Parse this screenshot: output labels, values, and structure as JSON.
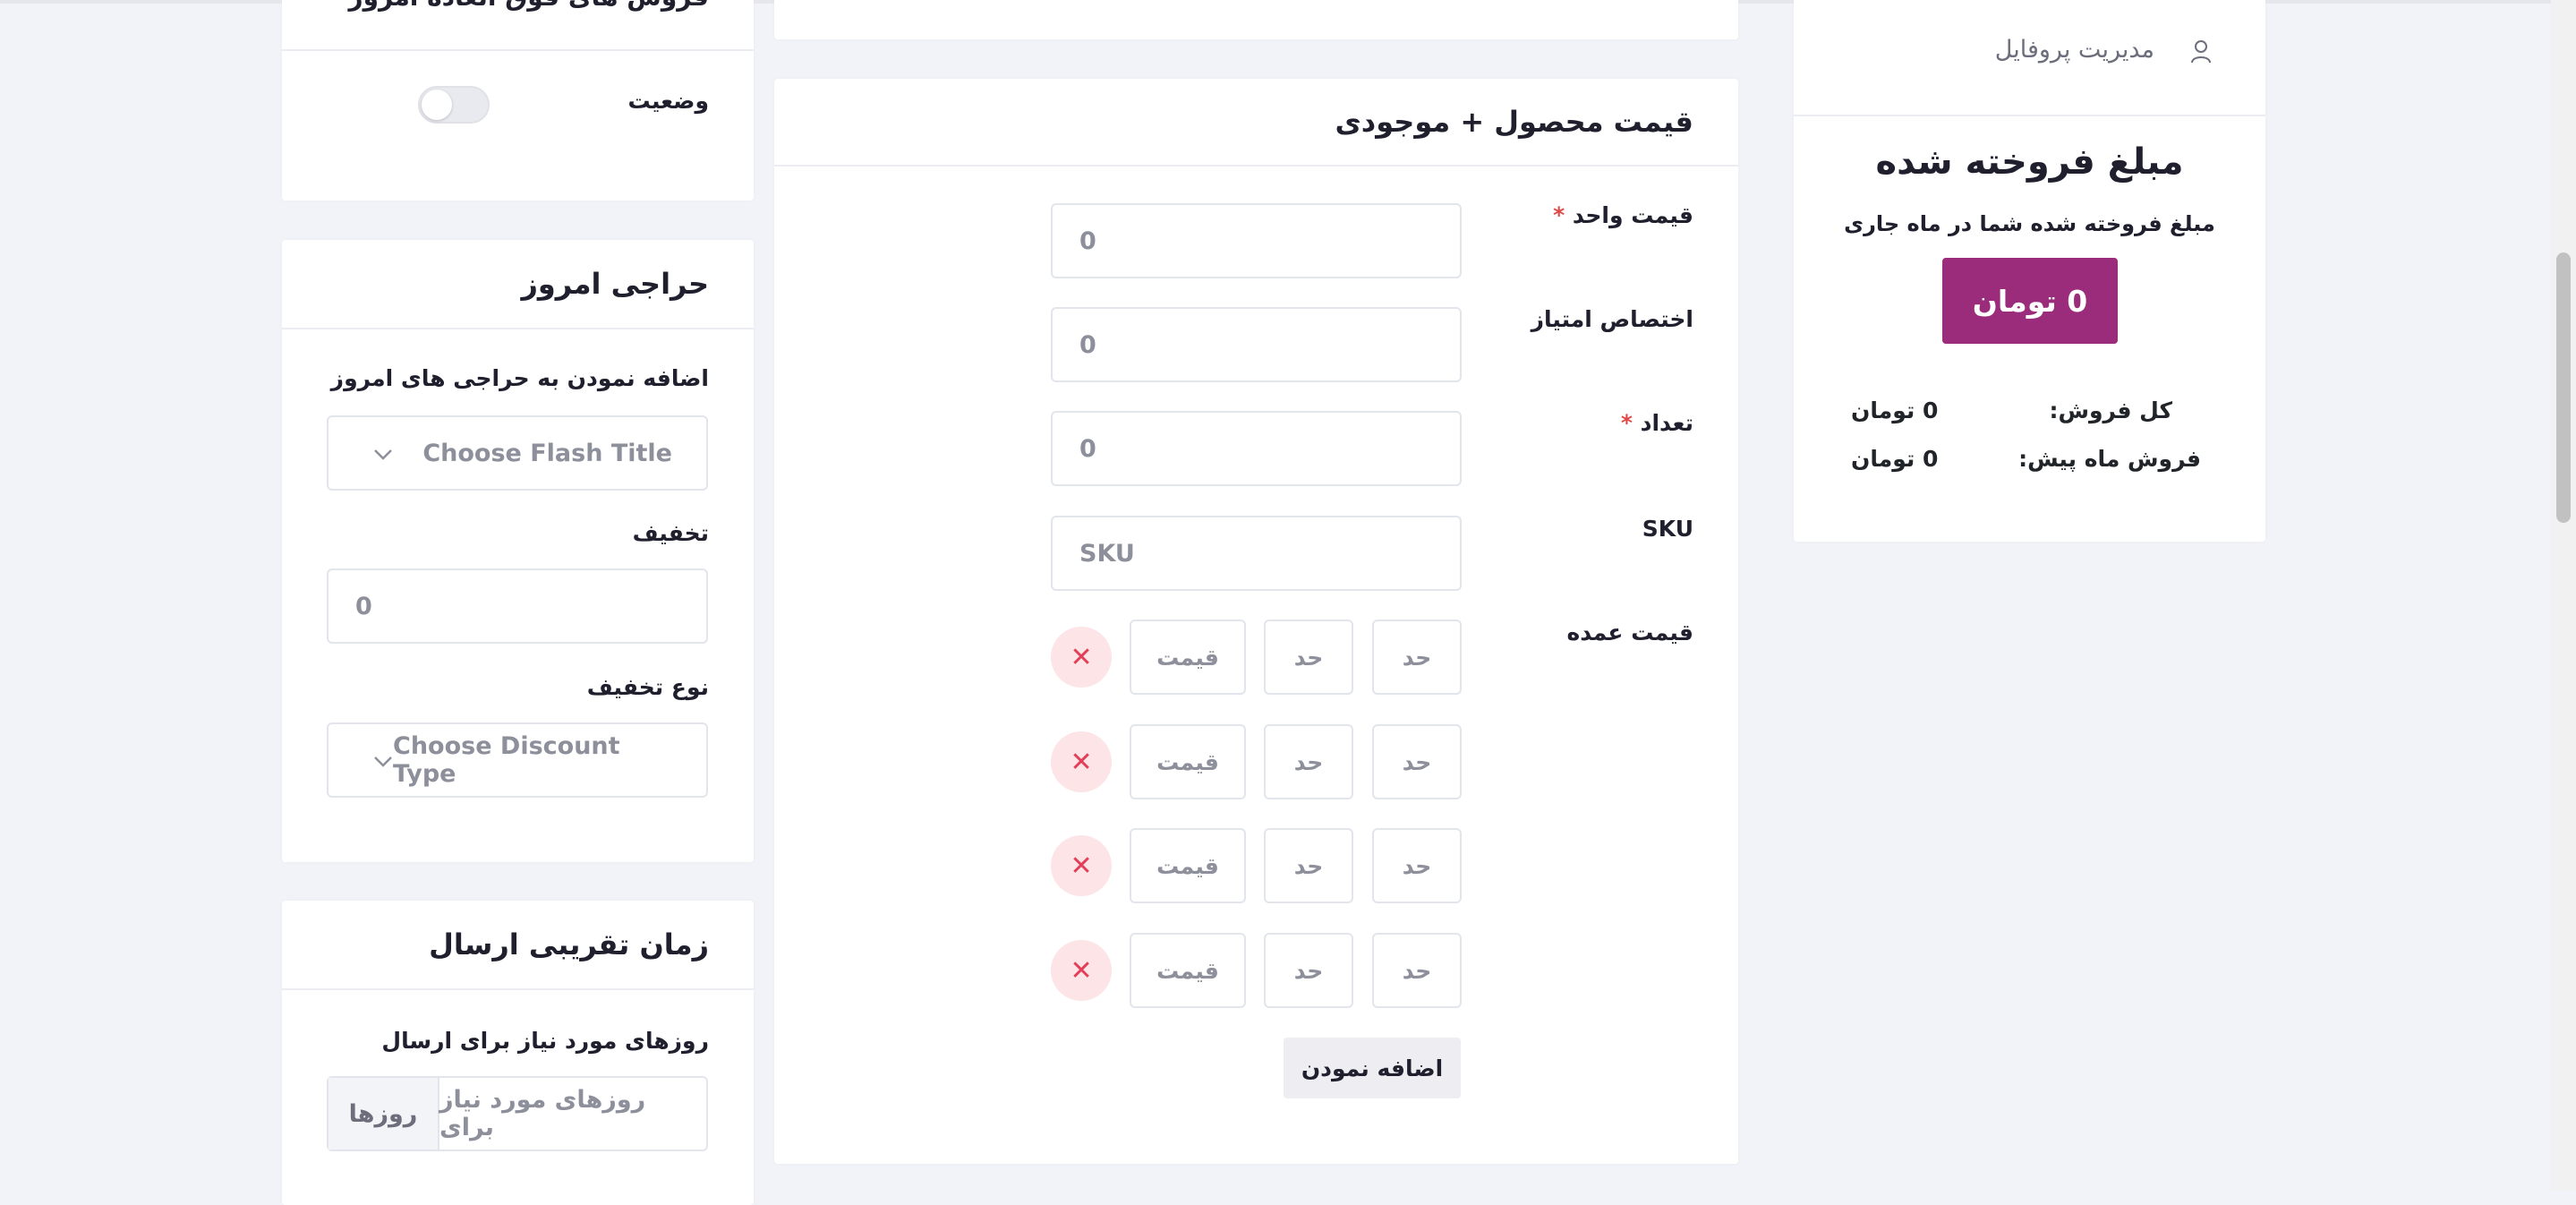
{
  "colors": {
    "accent": "#9b2c7b",
    "background": "#f2f3f8",
    "danger": "#e23e57",
    "danger_bg": "#fce4e7"
  },
  "left": {
    "top_card": {
      "partial_title": "فروش های فوق العاده امروز",
      "status_label": "وضعیت"
    },
    "flash": {
      "title": "حراجی امروز",
      "add_label": "اضافه نمودن به حراجی های امروز",
      "select_placeholder": "Choose Flash Title",
      "discount_label": "تخفیف",
      "discount_value": "0",
      "discount_type_label": "نوع تخفیف",
      "discount_type_placeholder": "Choose Discount Type"
    },
    "shipping": {
      "title": "زمان تقریبی ارسال",
      "days_label": "روزهای مورد نیاز برای ارسال",
      "days_placeholder": "روزهای مورد نیاز برای",
      "days_suffix": "روزها"
    }
  },
  "middle": {
    "title": "قیمت محصول + موجودی",
    "unit_price_label": "قیمت واحد",
    "unit_price_value": "0",
    "points_label": "اختصاص امتیاز",
    "points_value": "0",
    "quantity_label": "تعداد",
    "quantity_value": "0",
    "sku_label": "SKU",
    "sku_placeholder": "SKU",
    "wholesale_label": "قیمت عمده",
    "wholesale_rows": [
      {
        "min": "حد",
        "max": "حد",
        "price": "قیمت"
      },
      {
        "min": "حد",
        "max": "حد",
        "price": "قیمت"
      },
      {
        "min": "حد",
        "max": "حد",
        "price": "قیمت"
      },
      {
        "min": "حد",
        "max": "حد",
        "price": "قیمت"
      }
    ],
    "add_button": "اضافه نمودن",
    "required_mark": "*"
  },
  "right": {
    "profile_label": "مدیریت پروفایل",
    "sold_title": "مبلغ فروخته شده",
    "sold_subtitle": "مبلغ فروخته شده شما در ماه جاری",
    "sold_amount": "0 تومان",
    "total_sales_label": "کل فروش:",
    "total_sales_value": "0 تومان",
    "last_month_label": "فروش ماه پیش:",
    "last_month_value": "0 تومان"
  }
}
